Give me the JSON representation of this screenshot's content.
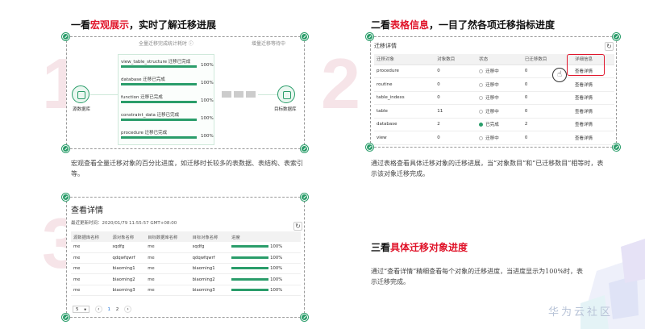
{
  "decor": {
    "numbers": [
      "1",
      "2",
      "3"
    ]
  },
  "brand": "华为云社区",
  "section1": {
    "heading_pre": "一看",
    "heading_hl": "宏观展示",
    "heading_post": "，实时了解迁移进展",
    "desc": "宏观查看全量迁移对象的百分比进度，如迁移时长较多的表数据、表结构、表索引等。",
    "flow": {
      "title_left": "全量迁移完成统计耗时 ⓘ",
      "title_right": "增量迁移等待中",
      "source_label": "源数据库",
      "target_label": "目标数据库",
      "steps": [
        {
          "label": "view_table_structure 迁移已完成",
          "pct_text": "100%",
          "pct": 100
        },
        {
          "label": "database 迁移已完成",
          "pct_text": "100%",
          "pct": 100
        },
        {
          "label": "function 迁移已完成",
          "pct_text": "100%",
          "pct": 100
        },
        {
          "label": "constraint_data 迁移已完成",
          "pct_text": "100%",
          "pct": 100
        },
        {
          "label": "procedure 迁移已完成",
          "pct_text": "100%",
          "pct": 100
        }
      ]
    }
  },
  "section2": {
    "heading_pre": "二看",
    "heading_hl": "表格信息",
    "heading_post": "，一目了然各项迁移指标进度",
    "desc": "通过表格查看具体迁移对象的迁移进展，当“对象数目”和“已迁移数目”相等时，表示该对象迁移完成。",
    "panel_title": "迁移详情",
    "columns": [
      "迁移对象",
      "对象数目",
      "状态",
      "已迁移数目",
      "详细信息"
    ],
    "rows": [
      {
        "object": "procedure",
        "count": "0",
        "status": "迁移中",
        "done": false,
        "migrated": "0",
        "action": "查看详情"
      },
      {
        "object": "routine",
        "count": "0",
        "status": "迁移中",
        "done": false,
        "migrated": "0",
        "action": "查看详情"
      },
      {
        "object": "table_indexs",
        "count": "0",
        "status": "迁移中",
        "done": false,
        "migrated": "0",
        "action": "查看详情"
      },
      {
        "object": "table",
        "count": "11",
        "status": "迁移中",
        "done": false,
        "migrated": "0",
        "action": "查看详情"
      },
      {
        "object": "database",
        "count": "2",
        "status": "已完成",
        "done": true,
        "migrated": "2",
        "action": "查看详情"
      },
      {
        "object": "view",
        "count": "0",
        "status": "迁移中",
        "done": false,
        "migrated": "0",
        "action": "查看详情"
      }
    ]
  },
  "section3": {
    "heading_pre": "三看",
    "heading_hl": "具体迁移对象进度",
    "heading_post": "",
    "desc": "通过“查看详情”精细查看每个对象的迁移进度，当进度显示为100%时，表示迁移完成。",
    "panel_title": "查看详情",
    "updated": "最近更新时间：2020/01/79 11:55:57 GMT+08:00",
    "columns": [
      "源数据库名称",
      "源对象名称",
      "目标数据库名称",
      "目标对象名称",
      "进度"
    ],
    "rows": [
      {
        "src_db": "me",
        "src_obj": "sqdfg",
        "dst_db": "me",
        "dst_obj": "sqdfg",
        "progress": "100%"
      },
      {
        "src_db": "me",
        "src_obj": "qdqwfqwrf",
        "dst_db": "me",
        "dst_obj": "qdqwfqwrf",
        "progress": "100%"
      },
      {
        "src_db": "me",
        "src_obj": "biaoming1",
        "dst_db": "me",
        "dst_obj": "biaoming1",
        "progress": "100%"
      },
      {
        "src_db": "me",
        "src_obj": "biaoming2",
        "dst_db": "me",
        "dst_obj": "biaoming2",
        "progress": "100%"
      },
      {
        "src_db": "me",
        "src_obj": "biaoming3",
        "dst_db": "me",
        "dst_obj": "biaoming3",
        "progress": "100%"
      }
    ],
    "pager": {
      "page_size": "5",
      "pages": [
        "1",
        "2"
      ],
      "prev": "‹",
      "next": "›"
    }
  },
  "icons": {
    "refresh": "↻",
    "hand": "☝"
  },
  "colors": {
    "accent_red": "#e0142a",
    "green": "#2a9d6a",
    "link": "#1a6fd6"
  }
}
